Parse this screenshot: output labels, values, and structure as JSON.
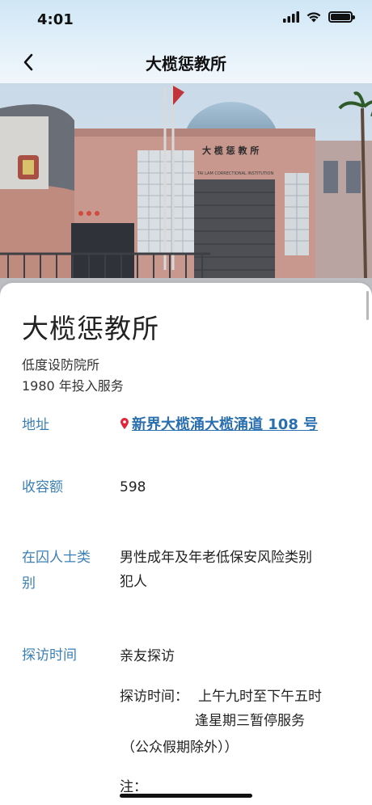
{
  "status_bar": {
    "time": "4:01"
  },
  "nav": {
    "title": "大榄惩教所"
  },
  "facility": {
    "name": "大榄惩教所",
    "type": "低度设防院所",
    "since": "1980 年投入服务"
  },
  "details": {
    "address_label": "地址",
    "address_value": "新界大榄涌大榄涌道 108 号",
    "capacity_label": "收容额",
    "capacity_value": "598",
    "inmate_label_line1": "在囚人士类",
    "inmate_label_line2": "别",
    "inmate_value_line1": "男性成年及年老低保安风险类别",
    "inmate_value_line2": "犯人",
    "visit_label": "探访时间",
    "visit_type": "亲友探访",
    "visit_hours_prefix": "探访时间：",
    "visit_hours_line1": "上午九时至下午五时",
    "visit_hours_line2": "逢星期三暂停服务",
    "visit_hours_line3": "（公众假期除外））",
    "note_label": "注："
  },
  "photo": {
    "sign_text": "大 榄 惩 教 所",
    "sign_text_en": "TAI LAM CORRECTIONAL INSTITUTION"
  },
  "colors": {
    "label": "#3a7fb5",
    "link": "#2a6fb0",
    "pin": "#e0253a",
    "header_bg": "#dcecf8"
  },
  "icons": {
    "back": "chevron-left-icon",
    "signal": "signal-icon",
    "wifi": "wifi-icon",
    "battery": "battery-icon",
    "pin": "location-pin-icon"
  }
}
